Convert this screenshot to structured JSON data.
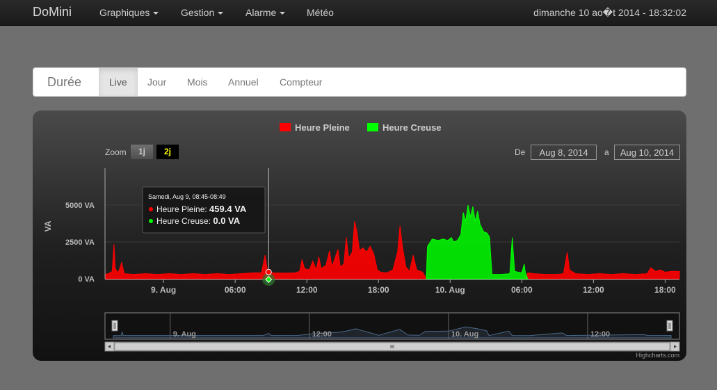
{
  "navbar": {
    "brand": "DoMini",
    "items": [
      {
        "label": "Graphiques",
        "dropdown": true
      },
      {
        "label": "Gestion",
        "dropdown": true
      },
      {
        "label": "Alarme",
        "dropdown": true
      },
      {
        "label": "Météo",
        "dropdown": false
      }
    ],
    "datetime": "dimanche 10 ao�t 2014 - 18:32:02"
  },
  "tabs": {
    "title": "Durée",
    "items": [
      "Live",
      "Jour",
      "Mois",
      "Annuel",
      "Compteur"
    ],
    "active": "Live"
  },
  "chart": {
    "legend": [
      {
        "label": "Heure Pleine",
        "color": "#ff0000"
      },
      {
        "label": "Heure Creuse",
        "color": "#00ff00"
      }
    ],
    "zoom_label": "Zoom",
    "zoom_buttons": [
      {
        "label": "1j",
        "selected": false
      },
      {
        "label": "2j",
        "selected": true
      }
    ],
    "from_label": "De",
    "from_value": "Aug 8, 2014",
    "to_label": "a",
    "to_value": "Aug 10, 2014",
    "credits": "Highcharts.com",
    "tooltip": {
      "header": "Samedi, Aug 9, 08:45-08:49",
      "rows": [
        {
          "series": "Heure Pleine",
          "value": "459.4 VA",
          "color": "#ff0000"
        },
        {
          "series": "Heure Creuse",
          "value": "0.0 VA",
          "color": "#00ff00"
        }
      ]
    },
    "navigator": {
      "labels": [
        "9. Aug",
        "12:00",
        "10. Aug",
        "12:00"
      ]
    }
  },
  "chart_data": {
    "type": "area",
    "xlabel": "",
    "ylabel": "VA",
    "ylim": [
      0,
      7500
    ],
    "ytick_labels": [
      "0 VA",
      "2500 VA",
      "5000 VA"
    ],
    "yticks": [
      0,
      2500,
      5000
    ],
    "xlim": [
      -4.9,
      19.2
    ],
    "x_unit": "hours relative to 9 Aug 00:00",
    "xtick_labels": [
      "9. Aug",
      "06:00",
      "12:00",
      "18:00",
      "10. Aug",
      "06:00",
      "12:00",
      "18:00"
    ],
    "xticks": [
      0,
      6,
      12,
      18,
      24,
      30,
      36,
      42
    ],
    "crosshair_x": 8.8,
    "series": [
      {
        "name": "Heure Pleine",
        "color": "#ff0000",
        "points": [
          [
            -4.9,
            300
          ],
          [
            -4.6,
            350
          ],
          [
            -4.3,
            500
          ],
          [
            -4.15,
            2350
          ],
          [
            -4.05,
            700
          ],
          [
            -3.8,
            400
          ],
          [
            -3.5,
            1100
          ],
          [
            -3.3,
            350
          ],
          [
            -2.5,
            300
          ],
          [
            -1.5,
            350
          ],
          [
            -0.5,
            300
          ],
          [
            0.5,
            350
          ],
          [
            1.5,
            300
          ],
          [
            2.5,
            350
          ],
          [
            3.5,
            300
          ],
          [
            4.5,
            350
          ],
          [
            5.5,
            300
          ],
          [
            6.5,
            350
          ],
          [
            7.5,
            400
          ],
          [
            8.2,
            400
          ],
          [
            8.5,
            1600
          ],
          [
            8.7,
            600
          ],
          [
            8.8,
            459
          ],
          [
            9.2,
            400
          ],
          [
            10,
            380
          ],
          [
            11,
            400
          ],
          [
            11.4,
            500
          ],
          [
            11.6,
            1300
          ],
          [
            11.8,
            700
          ],
          [
            12.2,
            600
          ],
          [
            12.5,
            1200
          ],
          [
            12.8,
            600
          ],
          [
            13.0,
            1500
          ],
          [
            13.2,
            700
          ],
          [
            13.6,
            900
          ],
          [
            13.9,
            1900
          ],
          [
            14.1,
            800
          ],
          [
            14.4,
            1500
          ],
          [
            14.6,
            2000
          ],
          [
            14.8,
            800
          ],
          [
            15.1,
            1000
          ],
          [
            15.3,
            2800
          ],
          [
            15.5,
            1400
          ],
          [
            15.8,
            1800
          ],
          [
            16.0,
            3900
          ],
          [
            16.2,
            3200
          ],
          [
            16.4,
            1900
          ],
          [
            16.7,
            2100
          ],
          [
            17.0,
            1800
          ],
          [
            17.3,
            2200
          ],
          [
            17.6,
            1700
          ],
          [
            17.9,
            600
          ],
          [
            18.2,
            450
          ],
          [
            18.7,
            400
          ],
          [
            19.2,
            600
          ],
          [
            19.6,
            1800
          ],
          [
            19.8,
            3600
          ],
          [
            20.0,
            2200
          ],
          [
            20.3,
            800
          ],
          [
            20.6,
            500
          ],
          [
            20.9,
            1600
          ],
          [
            21.2,
            600
          ],
          [
            21.7,
            450
          ],
          [
            22.0,
            0
          ],
          [
            30.2,
            0
          ],
          [
            30.5,
            400
          ],
          [
            31.0,
            350
          ],
          [
            32,
            300
          ],
          [
            33,
            300
          ],
          [
            33.5,
            350
          ],
          [
            33.8,
            1800
          ],
          [
            34.0,
            600
          ],
          [
            34.5,
            350
          ],
          [
            35.5,
            300
          ],
          [
            36.5,
            350
          ],
          [
            37.5,
            300
          ],
          [
            38.5,
            350
          ],
          [
            39.5,
            300
          ],
          [
            40.5,
            350
          ],
          [
            40.8,
            750
          ],
          [
            41.2,
            500
          ],
          [
            41.6,
            600
          ],
          [
            42.0,
            450
          ],
          [
            42.5,
            500
          ],
          [
            43.2,
            500
          ]
        ]
      },
      {
        "name": "Heure Creuse",
        "color": "#00ff00",
        "points": [
          [
            22.0,
            0
          ],
          [
            22.1,
            2200
          ],
          [
            22.5,
            2700
          ],
          [
            23.0,
            2600
          ],
          [
            23.4,
            2700
          ],
          [
            23.8,
            2600
          ],
          [
            24.1,
            2800
          ],
          [
            24.3,
            2500
          ],
          [
            24.6,
            2600
          ],
          [
            24.9,
            3000
          ],
          [
            25.1,
            4500
          ],
          [
            25.3,
            3900
          ],
          [
            25.5,
            5000
          ],
          [
            25.7,
            4200
          ],
          [
            25.9,
            4900
          ],
          [
            26.1,
            3900
          ],
          [
            26.3,
            4600
          ],
          [
            26.5,
            3700
          ],
          [
            26.8,
            3200
          ],
          [
            27.1,
            3100
          ],
          [
            27.3,
            2800
          ],
          [
            27.5,
            300
          ],
          [
            28.3,
            300
          ],
          [
            29.0,
            350
          ],
          [
            29.2,
            2800
          ],
          [
            29.4,
            500
          ],
          [
            30.0,
            400
          ],
          [
            30.2,
            1000
          ],
          [
            30.3,
            400
          ],
          [
            30.5,
            0
          ]
        ]
      }
    ],
    "navigator_series": [
      [
        -4.9,
        280
      ],
      [
        -4.2,
        320
      ],
      [
        -4.15,
        1600
      ],
      [
        -4.05,
        340
      ],
      [
        -3.3,
        330
      ],
      [
        0,
        320
      ],
      [
        4,
        330
      ],
      [
        8,
        330
      ],
      [
        8.5,
        1000
      ],
      [
        8.7,
        330
      ],
      [
        11,
        340
      ],
      [
        12,
        800
      ],
      [
        13.9,
        1300
      ],
      [
        14.6,
        1400
      ],
      [
        15.3,
        1900
      ],
      [
        16,
        2600
      ],
      [
        17,
        1500
      ],
      [
        18,
        400
      ],
      [
        19.8,
        2400
      ],
      [
        20.5,
        500
      ],
      [
        21.5,
        400
      ],
      [
        22,
        1700
      ],
      [
        24,
        1800
      ],
      [
        25.5,
        3200
      ],
      [
        26.5,
        2600
      ],
      [
        27.3,
        1900
      ],
      [
        27.5,
        300
      ],
      [
        29.2,
        1800
      ],
      [
        29.5,
        330
      ],
      [
        31,
        300
      ],
      [
        33.8,
        1200
      ],
      [
        34.2,
        320
      ],
      [
        40.8,
        600
      ],
      [
        41.2,
        350
      ],
      [
        43.2,
        330
      ]
    ]
  }
}
